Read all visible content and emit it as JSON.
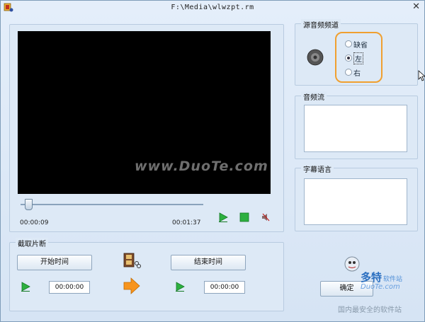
{
  "window": {
    "title": "F:\\Media\\wlwzpt.rm"
  },
  "video": {
    "watermark": "www.DuoTe.com",
    "time_current": "00:00:09",
    "time_total": "00:01:37",
    "progress": 0.09
  },
  "clip": {
    "legend": "截取片断",
    "start_button": "开始时间",
    "end_button": "结束时间",
    "start_time": "00:00:00",
    "end_time": "00:00:00"
  },
  "channel": {
    "legend": "源音频频道",
    "options": [
      "缺省",
      "左",
      "右"
    ],
    "selected": 1
  },
  "audio_stream": {
    "legend": "音频流"
  },
  "subtitle": {
    "legend": "字幕语言"
  },
  "ok_button": "确定",
  "brand": {
    "name": "多特",
    "suffix": "软件站",
    "url": "DuoTe.com",
    "slogan": "国内最安全的软件站"
  },
  "colors": {
    "highlight": "#f0a030",
    "play_green": "#2db040",
    "arrow_orange": "#f7941d"
  }
}
